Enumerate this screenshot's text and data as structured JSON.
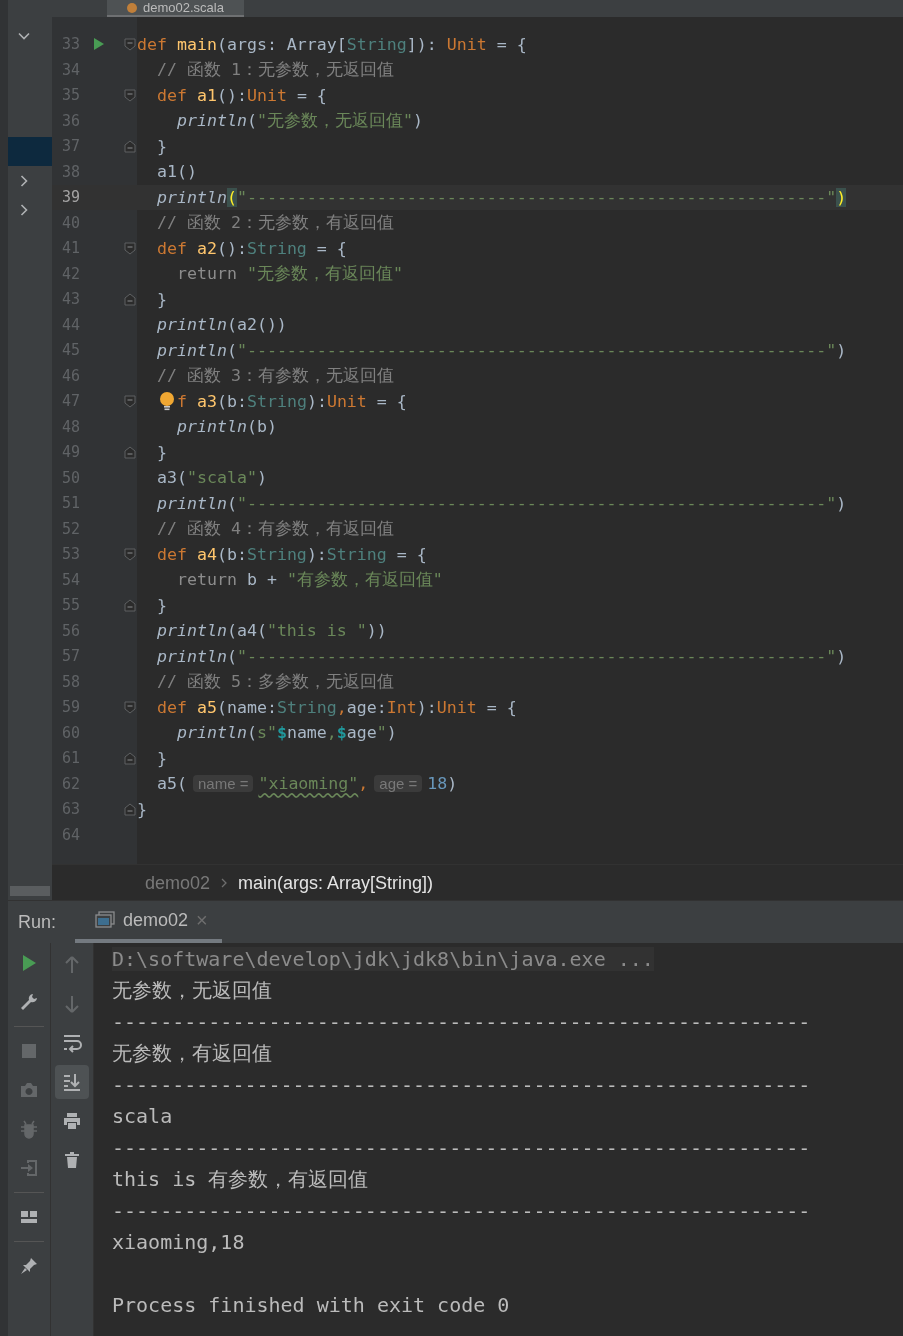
{
  "editor_tab": {
    "title": "demo02.scala"
  },
  "project_tree": [
    {
      "kind": "node",
      "expanded": true,
      "selected": false
    },
    {
      "kind": "leaf",
      "selected": false
    },
    {
      "kind": "leaf",
      "selected": false
    },
    {
      "kind": "leaf",
      "selected": false
    },
    {
      "kind": "leaf",
      "selected": true
    },
    {
      "kind": "node",
      "expanded": false,
      "selected": false
    },
    {
      "kind": "node",
      "expanded": false,
      "selected": false
    }
  ],
  "code_lines": [
    {
      "number": "33",
      "run": true,
      "kind": "opener",
      "tokens": [
        {
          "kind": "keyword",
          "text": "def "
        },
        {
          "kind": "function",
          "text": "main"
        },
        {
          "kind": "plain",
          "text": "(args: Array["
        },
        {
          "kind": "type",
          "text": "String"
        },
        {
          "kind": "plain",
          "text": "]): "
        },
        {
          "kind": "keyword",
          "text": "Unit"
        },
        {
          "kind": "plain",
          "text": " = {"
        }
      ]
    },
    {
      "number": "34",
      "tokens": [
        {
          "kind": "comment",
          "text": "  // 函数 1：无参数，无返回值"
        }
      ]
    },
    {
      "number": "35",
      "kind": "opener",
      "tokens": [
        {
          "kind": "keyword",
          "text": "  def "
        },
        {
          "kind": "function",
          "text": "a1"
        },
        {
          "kind": "plain",
          "text": "():"
        },
        {
          "kind": "keyword",
          "text": "Unit"
        },
        {
          "kind": "plain",
          "text": " = {"
        }
      ]
    },
    {
      "number": "36",
      "tokens": [
        {
          "kind": "call",
          "text": "    println"
        },
        {
          "kind": "plain",
          "text": "("
        },
        {
          "kind": "string",
          "text": "\"无参数，无返回值\""
        },
        {
          "kind": "plain",
          "text": ")"
        }
      ]
    },
    {
      "number": "37",
      "kind": "closer",
      "tokens": [
        {
          "kind": "plain",
          "text": "  }"
        }
      ]
    },
    {
      "number": "38",
      "tokens": [
        {
          "kind": "plain",
          "text": "  a1()"
        }
      ]
    },
    {
      "number": "39",
      "current": true,
      "tokens": [
        {
          "kind": "call",
          "text": "  println"
        },
        {
          "kind": "match",
          "text": "("
        },
        {
          "kind": "string",
          "text": "\"----------------------------------------------------------\""
        },
        {
          "kind": "match",
          "text": ")"
        }
      ]
    },
    {
      "number": "40",
      "tokens": [
        {
          "kind": "comment",
          "text": "  // 函数 2：无参数，有返回值"
        }
      ]
    },
    {
      "number": "41",
      "kind": "opener",
      "tokens": [
        {
          "kind": "keyword",
          "text": "  def "
        },
        {
          "kind": "function",
          "text": "a2"
        },
        {
          "kind": "plain",
          "text": "():"
        },
        {
          "kind": "type",
          "text": "String"
        },
        {
          "kind": "plain",
          "text": " = {"
        }
      ]
    },
    {
      "number": "42",
      "tokens": [
        {
          "kind": "return",
          "text": "    return "
        },
        {
          "kind": "string",
          "text": "\"无参数，有返回值\""
        }
      ]
    },
    {
      "number": "43",
      "kind": "closer",
      "tokens": [
        {
          "kind": "plain",
          "text": "  }"
        }
      ]
    },
    {
      "number": "44",
      "tokens": [
        {
          "kind": "call",
          "text": "  println"
        },
        {
          "kind": "plain",
          "text": "(a2())"
        }
      ]
    },
    {
      "number": "45",
      "tokens": [
        {
          "kind": "call",
          "text": "  println"
        },
        {
          "kind": "plain",
          "text": "("
        },
        {
          "kind": "string",
          "text": "\"----------------------------------------------------------\""
        },
        {
          "kind": "plain",
          "text": ")"
        }
      ]
    },
    {
      "number": "46",
      "tokens": [
        {
          "kind": "comment",
          "text": "  // 函数 3：有参数，无返回值"
        }
      ]
    },
    {
      "number": "47",
      "kind": "opener",
      "bulb": true,
      "tokens": [
        {
          "kind": "keyword",
          "text": "f "
        },
        {
          "kind": "function",
          "text": "a3"
        },
        {
          "kind": "plain",
          "text": "(b:"
        },
        {
          "kind": "type",
          "text": "String"
        },
        {
          "kind": "plain",
          "text": "):"
        },
        {
          "kind": "keyword",
          "text": "Unit"
        },
        {
          "kind": "plain",
          "text": " = {"
        }
      ]
    },
    {
      "number": "48",
      "tokens": [
        {
          "kind": "call",
          "text": "    println"
        },
        {
          "kind": "plain",
          "text": "(b)"
        }
      ]
    },
    {
      "number": "49",
      "kind": "closer",
      "tokens": [
        {
          "kind": "plain",
          "text": "  }"
        }
      ]
    },
    {
      "number": "50",
      "tokens": [
        {
          "kind": "plain",
          "text": "  a3("
        },
        {
          "kind": "string",
          "text": "\"scala\""
        },
        {
          "kind": "plain",
          "text": ")"
        }
      ]
    },
    {
      "number": "51",
      "tokens": [
        {
          "kind": "call",
          "text": "  println"
        },
        {
          "kind": "plain",
          "text": "("
        },
        {
          "kind": "string",
          "text": "\"----------------------------------------------------------\""
        },
        {
          "kind": "plain",
          "text": ")"
        }
      ]
    },
    {
      "number": "52",
      "tokens": [
        {
          "kind": "comment",
          "text": "  // 函数 4：有参数，有返回值"
        }
      ]
    },
    {
      "number": "53",
      "kind": "opener",
      "tokens": [
        {
          "kind": "keyword",
          "text": "  def "
        },
        {
          "kind": "function",
          "text": "a4"
        },
        {
          "kind": "plain",
          "text": "(b:"
        },
        {
          "kind": "type",
          "text": "String"
        },
        {
          "kind": "plain",
          "text": "):"
        },
        {
          "kind": "type",
          "text": "String"
        },
        {
          "kind": "plain",
          "text": " = {"
        }
      ]
    },
    {
      "number": "54",
      "tokens": [
        {
          "kind": "return",
          "text": "    return "
        },
        {
          "kind": "plain",
          "text": "b + "
        },
        {
          "kind": "string",
          "text": "\"有参数，有返回值\""
        }
      ]
    },
    {
      "number": "55",
      "kind": "closer",
      "tokens": [
        {
          "kind": "plain",
          "text": "  }"
        }
      ]
    },
    {
      "number": "56",
      "tokens": [
        {
          "kind": "call",
          "text": "  println"
        },
        {
          "kind": "plain",
          "text": "(a4("
        },
        {
          "kind": "string",
          "text": "\"this is \""
        },
        {
          "kind": "plain",
          "text": "))"
        }
      ]
    },
    {
      "number": "57",
      "tokens": [
        {
          "kind": "call",
          "text": "  println"
        },
        {
          "kind": "plain",
          "text": "("
        },
        {
          "kind": "string",
          "text": "\"----------------------------------------------------------\""
        },
        {
          "kind": "plain",
          "text": ")"
        }
      ]
    },
    {
      "number": "58",
      "tokens": [
        {
          "kind": "comment",
          "text": "  // 函数 5：多参数，无返回值"
        }
      ]
    },
    {
      "number": "59",
      "kind": "opener",
      "tokens": [
        {
          "kind": "keyword",
          "text": "  def "
        },
        {
          "kind": "function",
          "text": "a5"
        },
        {
          "kind": "plain",
          "text": "(name:"
        },
        {
          "kind": "type",
          "text": "String"
        },
        {
          "kind": "keyword",
          "text": ","
        },
        {
          "kind": "plain",
          "text": "age:"
        },
        {
          "kind": "keyword",
          "text": "Int"
        },
        {
          "kind": "plain",
          "text": "):"
        },
        {
          "kind": "keyword",
          "text": "Unit"
        },
        {
          "kind": "plain",
          "text": " = {"
        }
      ]
    },
    {
      "number": "60",
      "tokens": [
        {
          "kind": "call",
          "text": "    println"
        },
        {
          "kind": "plain",
          "text": "("
        },
        {
          "kind": "string",
          "text": "s\""
        },
        {
          "kind": "interp",
          "text": "$"
        },
        {
          "kind": "plain",
          "text": "name"
        },
        {
          "kind": "string",
          "text": ","
        },
        {
          "kind": "interp",
          "text": "$"
        },
        {
          "kind": "plain",
          "text": "age"
        },
        {
          "kind": "string",
          "text": "\""
        },
        {
          "kind": "plain",
          "text": ")"
        }
      ]
    },
    {
      "number": "61",
      "kind": "closer",
      "tokens": [
        {
          "kind": "plain",
          "text": "  }"
        }
      ]
    },
    {
      "number": "62",
      "tokens": [
        {
          "kind": "plain",
          "text": "  a5("
        },
        {
          "kind": "hint",
          "text": "name ="
        },
        {
          "kind": "warning",
          "text": "\"xiaoming\""
        },
        {
          "kind": "keyword",
          "text": ","
        },
        {
          "kind": "hint",
          "text": "age ="
        },
        {
          "kind": "number",
          "text": "18"
        },
        {
          "kind": "plain",
          "text": ")"
        }
      ]
    },
    {
      "number": "63",
      "kind": "closer",
      "tokens": [
        {
          "kind": "plain",
          "text": "}"
        }
      ]
    },
    {
      "number": "64"
    }
  ],
  "breadcrumbs": [
    {
      "text": "demo02",
      "selected": false
    },
    {
      "text": "main(args: Array[String])",
      "selected": true
    }
  ],
  "run_panel": {
    "label": "Run:",
    "tab": {
      "title": "demo02",
      "close": "×",
      "selected": true
    }
  },
  "run_toolbar": [
    {
      "kind": "rerun",
      "disabled": false
    },
    {
      "kind": "wrench",
      "disabled": false
    },
    {
      "kind": "separator"
    },
    {
      "kind": "stop",
      "disabled": true
    },
    {
      "kind": "camera",
      "disabled": true
    },
    {
      "kind": "bug",
      "disabled": true
    },
    {
      "kind": "login",
      "disabled": true
    },
    {
      "kind": "separator"
    },
    {
      "kind": "layout",
      "disabled": false
    },
    {
      "kind": "separator"
    },
    {
      "kind": "pin",
      "disabled": false
    }
  ],
  "console_toolbar": [
    {
      "kind": "up",
      "disabled": true,
      "selected": false
    },
    {
      "kind": "down",
      "disabled": true,
      "selected": false
    },
    {
      "kind": "wrap",
      "disabled": false,
      "selected": false
    },
    {
      "kind": "scroll",
      "disabled": false,
      "selected": true
    },
    {
      "kind": "print",
      "disabled": false,
      "selected": false
    },
    {
      "kind": "trash",
      "disabled": false,
      "selected": false
    }
  ],
  "console_lines": [
    {
      "kind": "command",
      "text": "D:\\software\\develop\\jdk\\jdk8\\bin\\java.exe ..."
    },
    {
      "kind": "output",
      "text": "无参数，无返回值"
    },
    {
      "kind": "output",
      "text": "----------------------------------------------------------"
    },
    {
      "kind": "output",
      "text": "无参数，有返回值"
    },
    {
      "kind": "output",
      "text": "----------------------------------------------------------"
    },
    {
      "kind": "output",
      "text": "scala"
    },
    {
      "kind": "output",
      "text": "----------------------------------------------------------"
    },
    {
      "kind": "output",
      "text": "this is 有参数，有返回值"
    },
    {
      "kind": "output",
      "text": "----------------------------------------------------------"
    },
    {
      "kind": "output",
      "text": "xiaoming,18"
    },
    {
      "kind": "exit",
      "text": "Process finished with exit code 0"
    }
  ]
}
